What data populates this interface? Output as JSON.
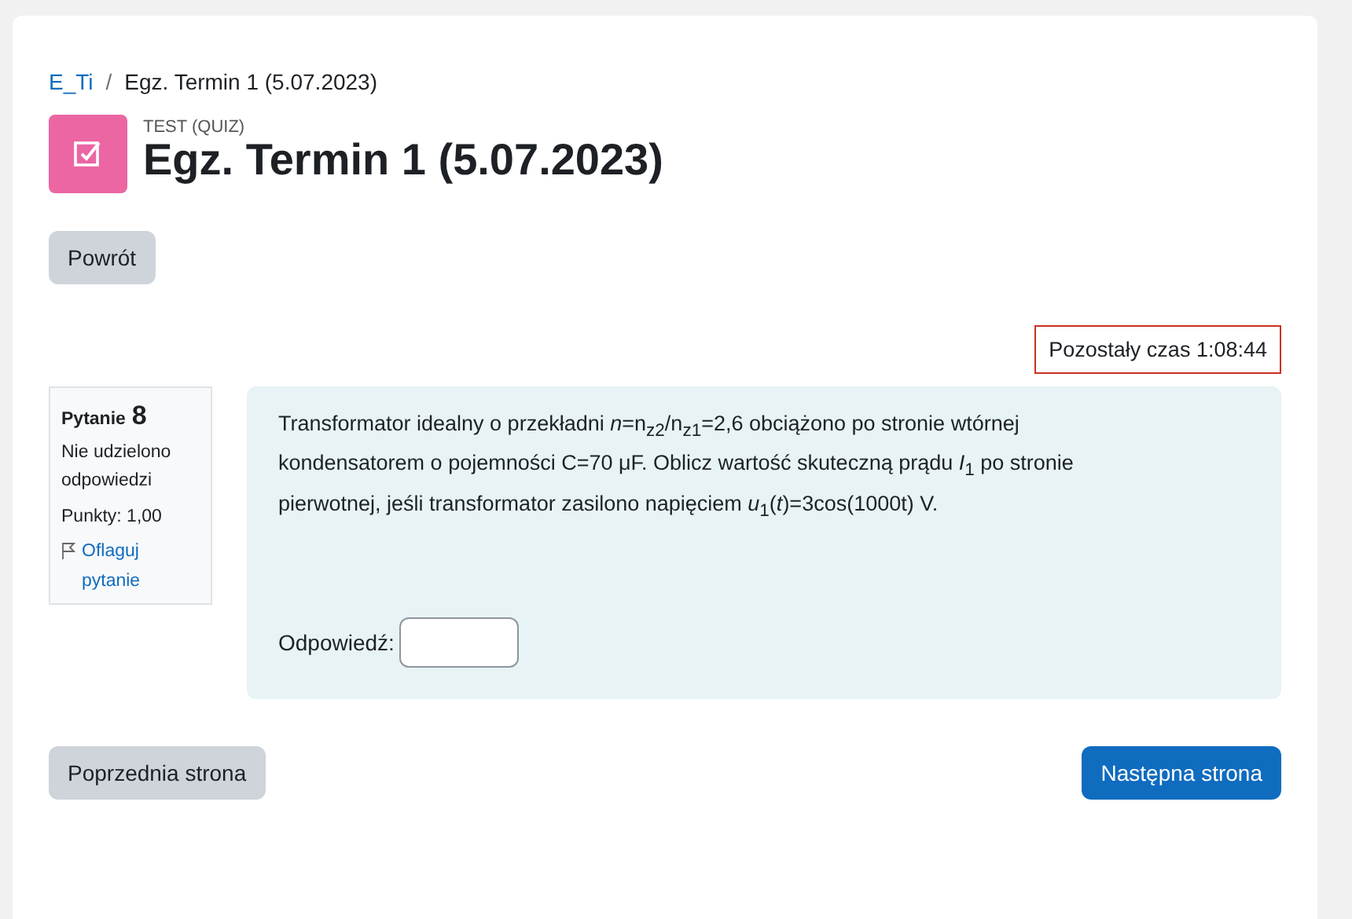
{
  "breadcrumb_separator": "/",
  "breadcrumb": [
    {
      "label": "E_Ti",
      "link": true
    },
    {
      "label": "Egz. Termin 1 (5.07.2023)",
      "link": false
    }
  ],
  "activity_type": "TEST (QUIZ)",
  "title": "Egz. Termin 1 (5.07.2023)",
  "back_button": "Powrót",
  "timer": "Pozostały czas 1:08:44",
  "question_info": {
    "label": "Pytanie",
    "number": "8",
    "status": "Nie udzielono odpowiedzi",
    "points": "Punkty: 1,00",
    "flag_link": "Oflaguj pytanie",
    "flagged": false
  },
  "question": {
    "text": "Transformator idealny o przekładni *n*=n$_{z2}$/n$_{z1}$=2,6 obciążono po stronie wtórnej kondensatorem o pojemności C=70 μF. Oblicz wartość skuteczną prądu *I*$_{1}$  po stronie pierwotnej, jeśli  transformator zasilono napięciem *u*$_{1}$(*t*)=3cos(1000t) V.",
    "answer_label": "Odpowiedź:"
  },
  "navigation": [
    {
      "label": "Poprzednia strona",
      "primary": false
    },
    {
      "label": "Następna strona",
      "primary": true
    }
  ]
}
